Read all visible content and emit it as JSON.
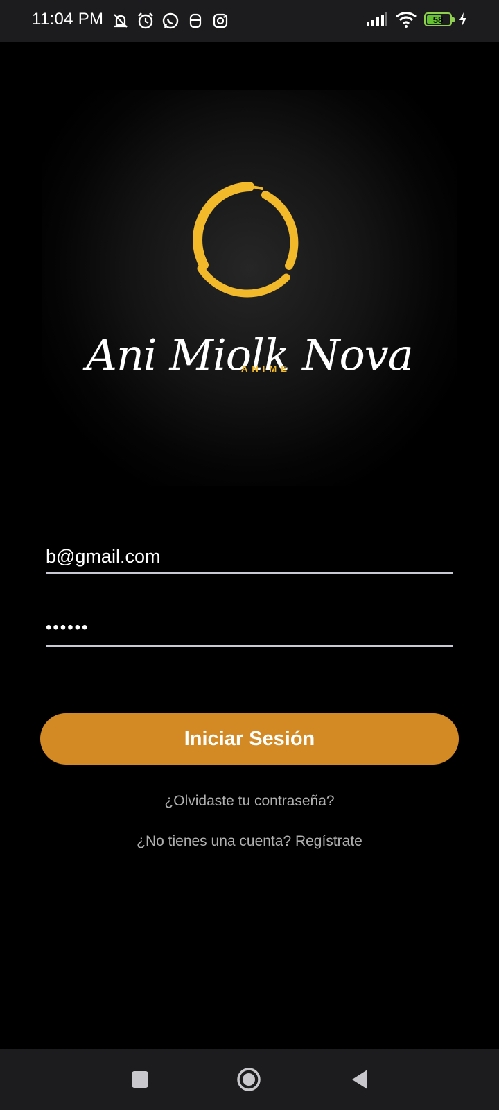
{
  "status_bar": {
    "time": "11:04 PM",
    "left_icons": [
      "muted-notification-icon",
      "alarm-icon",
      "whatsapp-icon",
      "app-notification-icon",
      "instagram-icon"
    ],
    "right_icons": [
      "signal-icon",
      "wifi-icon",
      "battery-icon",
      "charging-icon"
    ],
    "battery_level": "58"
  },
  "logo": {
    "brand_name": "Ani Miolk Nova",
    "brand_tagline": "ANIME",
    "accent_color": "#f2b92b"
  },
  "login_form": {
    "email_value": "b@gmail.com",
    "password_value": "••••••",
    "submit_label": "Iniciar Sesión",
    "submit_color": "#d38a25"
  },
  "links": {
    "forgot_password": "¿Olvidaste tu contraseña?",
    "register": "¿No tienes una cuenta? Regístrate"
  },
  "nav_bar": {
    "buttons": [
      "recents-icon",
      "home-icon",
      "back-icon"
    ]
  }
}
